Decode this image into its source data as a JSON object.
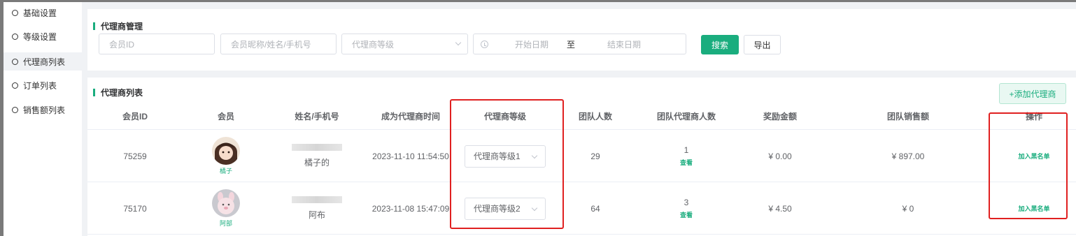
{
  "sidebar": {
    "items": [
      {
        "label": "基础设置",
        "active": false
      },
      {
        "label": "等级设置",
        "active": false
      },
      {
        "label": "代理商列表",
        "active": true
      },
      {
        "label": "订单列表",
        "active": false
      },
      {
        "label": "销售额列表",
        "active": false
      }
    ]
  },
  "filter": {
    "title": "代理商管理",
    "member_id_placeholder": "会员ID",
    "member_info_placeholder": "会员昵称/姓名/手机号",
    "level_placeholder": "代理商等级",
    "date_start_placeholder": "开始日期",
    "date_separator": "至",
    "date_end_placeholder": "结束日期",
    "search_label": "搜索",
    "export_label": "导出"
  },
  "list": {
    "title": "代理商列表",
    "add_label": "+添加代理商",
    "columns": [
      "会员ID",
      "会员",
      "姓名/手机号",
      "成为代理商时间",
      "代理商等级",
      "团队人数",
      "团队代理商人数",
      "奖励金额",
      "团队销售额",
      "操作"
    ],
    "rows": [
      {
        "member_id": "75259",
        "nickname": "橘子",
        "name": "橘子的",
        "joined": "2023-11-10 11:54:50",
        "level": "代理商等级1",
        "team_size": "29",
        "team_agents": "1",
        "view_label": "查看",
        "reward": "¥ 0.00",
        "team_sales": "¥ 897.00",
        "action_label": "加入黑名单"
      },
      {
        "member_id": "75170",
        "nickname": "阿部",
        "name": "阿布",
        "joined": "2023-11-08 15:47:09",
        "level": "代理商等级2",
        "team_size": "64",
        "team_agents": "3",
        "view_label": "查看",
        "reward": "¥ 4.50",
        "team_sales": "¥ 0",
        "action_label": "加入黑名单"
      }
    ]
  },
  "colors": {
    "accent": "#1aad7e",
    "highlight_box": "#e02020"
  }
}
